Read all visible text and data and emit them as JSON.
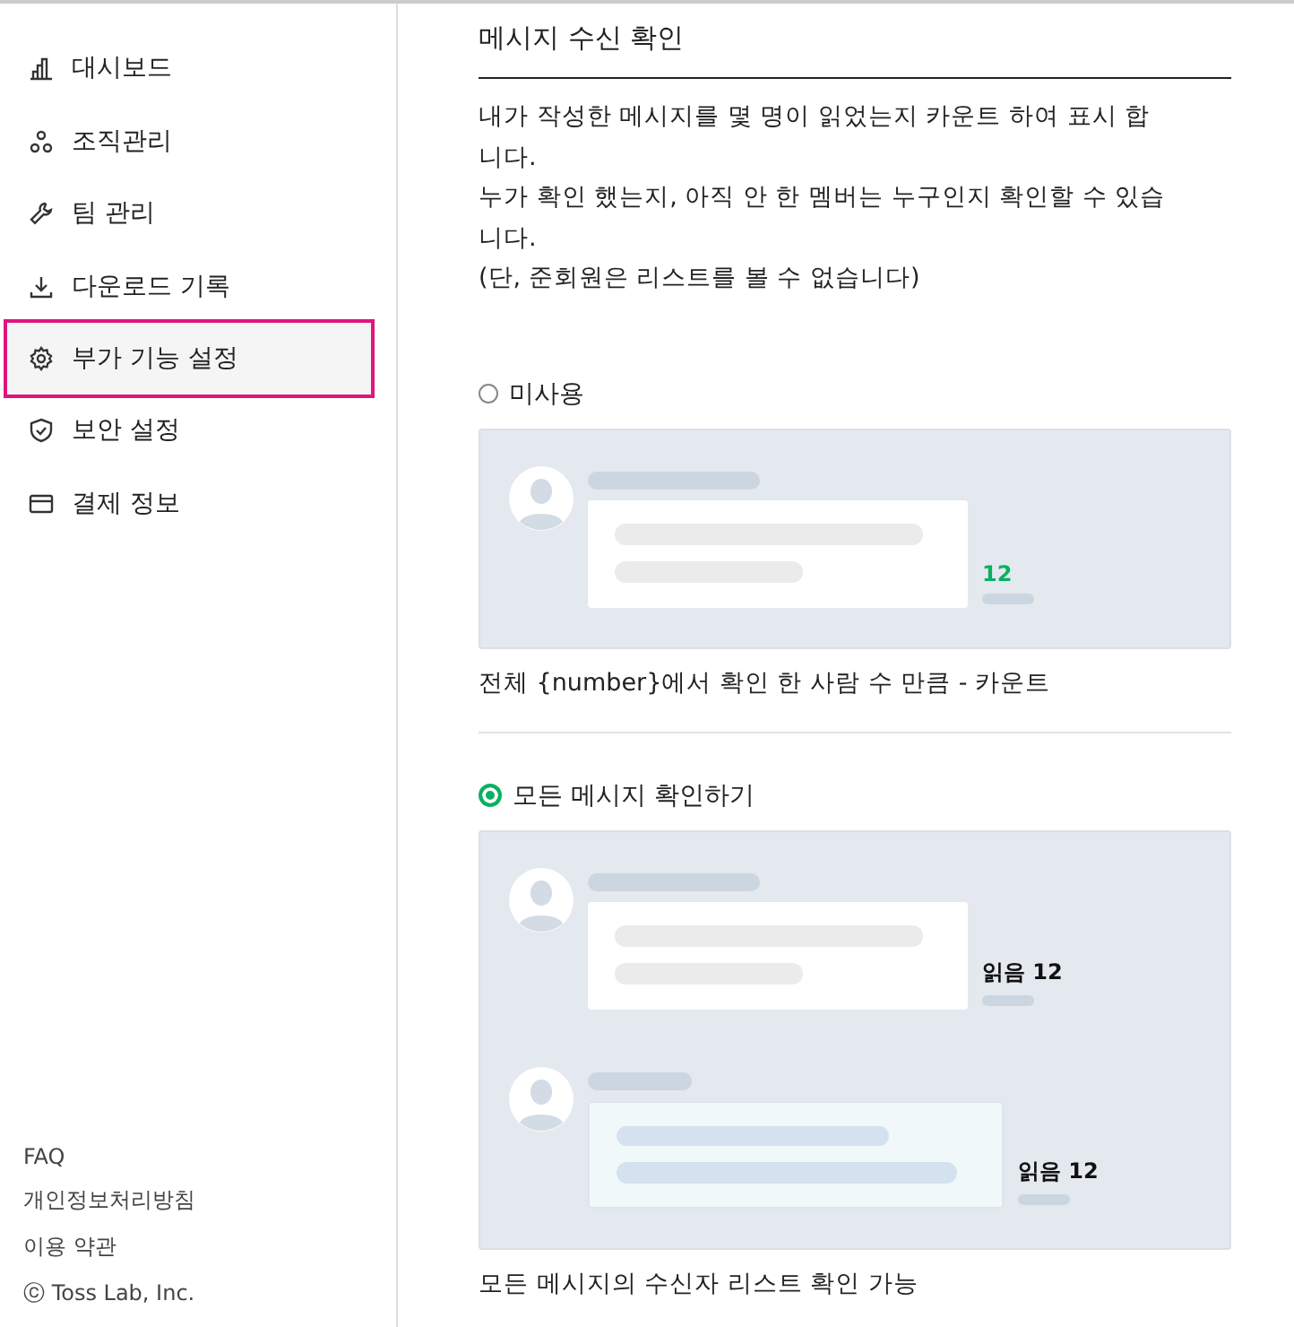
{
  "sidebar": {
    "items": [
      {
        "label": "대시보드",
        "selected": false
      },
      {
        "label": "조직관리",
        "selected": false
      },
      {
        "label": "팀 관리",
        "selected": false
      },
      {
        "label": "다운로드 기록",
        "selected": false
      },
      {
        "label": "부가 기능 설정",
        "selected": true
      },
      {
        "label": "보안 설정",
        "selected": false
      },
      {
        "label": "결제 정보",
        "selected": false
      }
    ],
    "footer_links": [
      "FAQ",
      "개인정보처리방침",
      "이용 약관"
    ],
    "copyright": "ⓒ Toss Lab, Inc."
  },
  "section": {
    "title": "메시지 수신 확인",
    "description": [
      "내가 작성한 메시지를 몇 명이 읽었는지 카운트 하여 표시 합니다.",
      "누가 확인 했는지, 아직 안 한 멤버는 누구인지 확인할 수 있습니다.",
      "(단, 준회원은 리스트를 볼 수 없습니다)"
    ],
    "options": [
      {
        "label": "미사용",
        "selected": false,
        "caption": "전체 {number}에서 확인 한 사람 수 만큼 - 카운트",
        "messages": [
          {
            "count": "12",
            "accent": true,
            "highlighted": false
          }
        ]
      },
      {
        "label": "모든 메시지 확인하기",
        "selected": true,
        "caption": "모든 메시지의 수신자 리스트 확인 가능",
        "messages": [
          {
            "count": "읽음 12",
            "accent": false,
            "highlighted": false
          },
          {
            "count": "읽음 12",
            "accent": false,
            "highlighted": true
          }
        ]
      }
    ]
  }
}
